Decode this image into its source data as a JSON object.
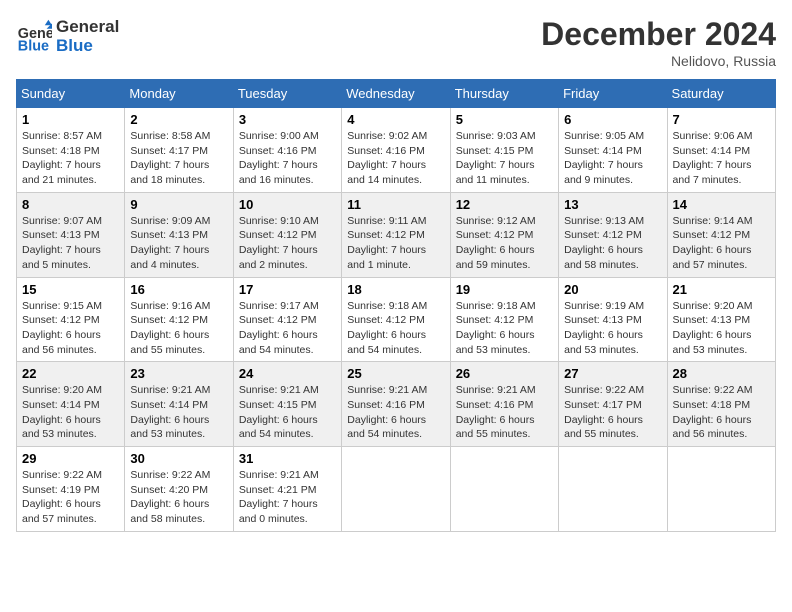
{
  "logo": {
    "text_general": "General",
    "text_blue": "Blue"
  },
  "title": "December 2024",
  "location": "Nelidovo, Russia",
  "days_of_week": [
    "Sunday",
    "Monday",
    "Tuesday",
    "Wednesday",
    "Thursday",
    "Friday",
    "Saturday"
  ],
  "weeks": [
    [
      {
        "day": "1",
        "sunrise": "8:57 AM",
        "sunset": "4:18 PM",
        "daylight": "7 hours and 21 minutes."
      },
      {
        "day": "2",
        "sunrise": "8:58 AM",
        "sunset": "4:17 PM",
        "daylight": "7 hours and 18 minutes."
      },
      {
        "day": "3",
        "sunrise": "9:00 AM",
        "sunset": "4:16 PM",
        "daylight": "7 hours and 16 minutes."
      },
      {
        "day": "4",
        "sunrise": "9:02 AM",
        "sunset": "4:16 PM",
        "daylight": "7 hours and 14 minutes."
      },
      {
        "day": "5",
        "sunrise": "9:03 AM",
        "sunset": "4:15 PM",
        "daylight": "7 hours and 11 minutes."
      },
      {
        "day": "6",
        "sunrise": "9:05 AM",
        "sunset": "4:14 PM",
        "daylight": "7 hours and 9 minutes."
      },
      {
        "day": "7",
        "sunrise": "9:06 AM",
        "sunset": "4:14 PM",
        "daylight": "7 hours and 7 minutes."
      }
    ],
    [
      {
        "day": "8",
        "sunrise": "9:07 AM",
        "sunset": "4:13 PM",
        "daylight": "7 hours and 5 minutes."
      },
      {
        "day": "9",
        "sunrise": "9:09 AM",
        "sunset": "4:13 PM",
        "daylight": "7 hours and 4 minutes."
      },
      {
        "day": "10",
        "sunrise": "9:10 AM",
        "sunset": "4:12 PM",
        "daylight": "7 hours and 2 minutes."
      },
      {
        "day": "11",
        "sunrise": "9:11 AM",
        "sunset": "4:12 PM",
        "daylight": "7 hours and 1 minute."
      },
      {
        "day": "12",
        "sunrise": "9:12 AM",
        "sunset": "4:12 PM",
        "daylight": "6 hours and 59 minutes."
      },
      {
        "day": "13",
        "sunrise": "9:13 AM",
        "sunset": "4:12 PM",
        "daylight": "6 hours and 58 minutes."
      },
      {
        "day": "14",
        "sunrise": "9:14 AM",
        "sunset": "4:12 PM",
        "daylight": "6 hours and 57 minutes."
      }
    ],
    [
      {
        "day": "15",
        "sunrise": "9:15 AM",
        "sunset": "4:12 PM",
        "daylight": "6 hours and 56 minutes."
      },
      {
        "day": "16",
        "sunrise": "9:16 AM",
        "sunset": "4:12 PM",
        "daylight": "6 hours and 55 minutes."
      },
      {
        "day": "17",
        "sunrise": "9:17 AM",
        "sunset": "4:12 PM",
        "daylight": "6 hours and 54 minutes."
      },
      {
        "day": "18",
        "sunrise": "9:18 AM",
        "sunset": "4:12 PM",
        "daylight": "6 hours and 54 minutes."
      },
      {
        "day": "19",
        "sunrise": "9:18 AM",
        "sunset": "4:12 PM",
        "daylight": "6 hours and 53 minutes."
      },
      {
        "day": "20",
        "sunrise": "9:19 AM",
        "sunset": "4:13 PM",
        "daylight": "6 hours and 53 minutes."
      },
      {
        "day": "21",
        "sunrise": "9:20 AM",
        "sunset": "4:13 PM",
        "daylight": "6 hours and 53 minutes."
      }
    ],
    [
      {
        "day": "22",
        "sunrise": "9:20 AM",
        "sunset": "4:14 PM",
        "daylight": "6 hours and 53 minutes."
      },
      {
        "day": "23",
        "sunrise": "9:21 AM",
        "sunset": "4:14 PM",
        "daylight": "6 hours and 53 minutes."
      },
      {
        "day": "24",
        "sunrise": "9:21 AM",
        "sunset": "4:15 PM",
        "daylight": "6 hours and 54 minutes."
      },
      {
        "day": "25",
        "sunrise": "9:21 AM",
        "sunset": "4:16 PM",
        "daylight": "6 hours and 54 minutes."
      },
      {
        "day": "26",
        "sunrise": "9:21 AM",
        "sunset": "4:16 PM",
        "daylight": "6 hours and 55 minutes."
      },
      {
        "day": "27",
        "sunrise": "9:22 AM",
        "sunset": "4:17 PM",
        "daylight": "6 hours and 55 minutes."
      },
      {
        "day": "28",
        "sunrise": "9:22 AM",
        "sunset": "4:18 PM",
        "daylight": "6 hours and 56 minutes."
      }
    ],
    [
      {
        "day": "29",
        "sunrise": "9:22 AM",
        "sunset": "4:19 PM",
        "daylight": "6 hours and 57 minutes."
      },
      {
        "day": "30",
        "sunrise": "9:22 AM",
        "sunset": "4:20 PM",
        "daylight": "6 hours and 58 minutes."
      },
      {
        "day": "31",
        "sunrise": "9:21 AM",
        "sunset": "4:21 PM",
        "daylight": "7 hours and 0 minutes."
      },
      null,
      null,
      null,
      null
    ]
  ],
  "labels": {
    "sunrise": "Sunrise:",
    "sunset": "Sunset:",
    "daylight": "Daylight:"
  }
}
